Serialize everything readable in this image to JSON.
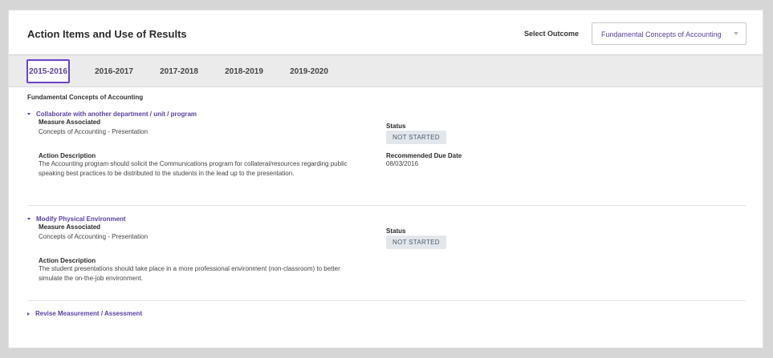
{
  "header": {
    "title": "Action Items and Use of Results",
    "select_label": "Select Outcome",
    "selected_outcome": "Fundamental Concepts of Accounting"
  },
  "tabs": [
    {
      "label": "2015-2016",
      "active": true
    },
    {
      "label": "2016-2017",
      "active": false
    },
    {
      "label": "2017-2018",
      "active": false
    },
    {
      "label": "2018-2019",
      "active": false
    },
    {
      "label": "2019-2020",
      "active": false
    }
  ],
  "outcome_heading": "Fundamental Concepts of Accounting",
  "labels": {
    "measure": "Measure Associated",
    "action": "Action Description",
    "status": "Status",
    "due_date": "Recommended Due Date"
  },
  "items": [
    {
      "title": "Collaborate with another department / unit / program",
      "expanded": true,
      "measure": "Concepts of Accounting - Presentation",
      "action": "The Accounting program should solicit the Communications program for collateral/resources regarding public speaking best practices to be distributed to the students in the lead up to the presentation.",
      "status": "NOT STARTED",
      "due_date": "08/03/2016"
    },
    {
      "title": "Modify Physical Environment",
      "expanded": true,
      "measure": "Concepts of Accounting - Presentation",
      "action": "The student presentations should take place in a more professional environment (non-classroom) to better simulate the on-the-job environment.",
      "status": "NOT STARTED"
    },
    {
      "title": "Revise Measurement / Assessment",
      "expanded": false
    }
  ],
  "colors": {
    "accent": "#5a3fa5",
    "active_tab_border": "#6a44c8",
    "badge_bg": "#e3e7ec",
    "page_bg": "#d6d6d6"
  }
}
